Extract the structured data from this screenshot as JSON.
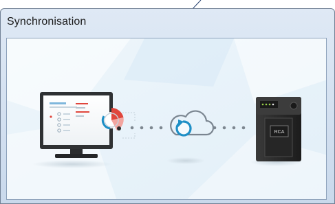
{
  "window": {
    "title": "Synchronisation"
  },
  "scene": {
    "device_label": "RCA",
    "icons": [
      "monitor-icon",
      "pie-chart-icon",
      "sync-cloud-icon",
      "rca-device-icon"
    ]
  },
  "colors": {
    "accent": "#1e8fc6",
    "title_text": "#1a1a1a",
    "monitor_frame": "#2f3133",
    "device_body": "#2e2e2e",
    "pie_red": "#e0463c"
  }
}
